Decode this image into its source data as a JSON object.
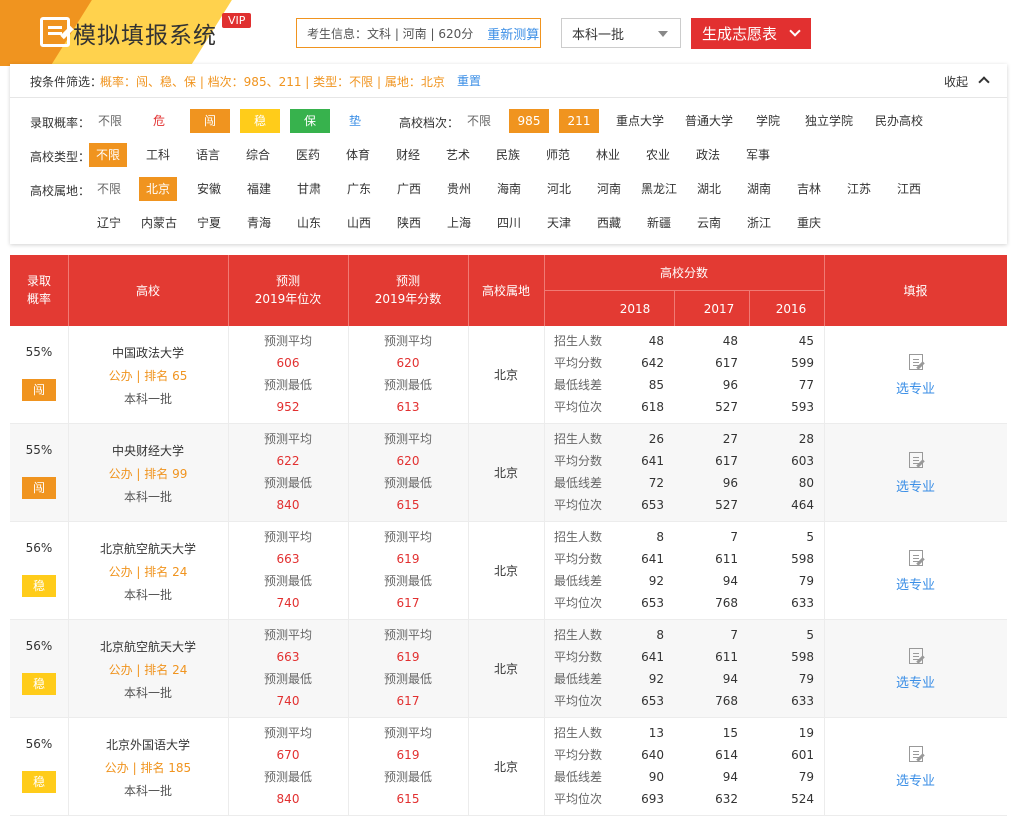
{
  "header": {
    "app_title": "模拟填报系统",
    "vip_label": "VIP",
    "student_info": "考生信息：文科 | 河南 | 620分",
    "remeasure_label": "重新测算",
    "batch_selected": "本科一批",
    "generate_label": "生成志愿表"
  },
  "colors": {
    "brand_orange": "#f0941f",
    "brand_yellow": "#ffd24d",
    "header_red": "#e33a33",
    "link_blue": "#3a8ee6",
    "wen": "#f0941f",
    "wen_text": "#ffffff",
    "wen2": "#ffcc1a",
    "bao": "#37b24d",
    "dian": "#3a8ee6"
  },
  "filter": {
    "summary_label": "按条件筛选：",
    "summary_value": "概率：闯、稳、保 | 档次：985、211 | 类型：不限 | 属地：北京",
    "reset_label": "重置",
    "collapse_label": "收起",
    "prob": {
      "label": "录取概率：",
      "options": [
        "不限",
        "危",
        "闯",
        "稳",
        "保",
        "垫"
      ]
    },
    "level": {
      "label": "高校档次：",
      "options": [
        "不限",
        "985",
        "211",
        "重点大学",
        "普通大学",
        "学院",
        "独立学院",
        "民办高校"
      ]
    },
    "type": {
      "label": "高校类型：",
      "options": [
        "不限",
        "工科",
        "语言",
        "综合",
        "医药",
        "体育",
        "财经",
        "艺术",
        "民族",
        "师范",
        "林业",
        "农业",
        "政法",
        "军事"
      ]
    },
    "location": {
      "label": "高校属地：",
      "row1": [
        "不限",
        "北京",
        "安徽",
        "福建",
        "甘肃",
        "广东",
        "广西",
        "贵州",
        "海南",
        "河北",
        "河南",
        "黑龙江",
        "湖北",
        "湖南",
        "吉林",
        "江苏",
        "江西"
      ],
      "row2": [
        "辽宁",
        "内蒙古",
        "宁夏",
        "青海",
        "山东",
        "山西",
        "陕西",
        "上海",
        "四川",
        "天津",
        "西藏",
        "新疆",
        "云南",
        "浙江",
        "重庆"
      ]
    }
  },
  "table": {
    "headers": {
      "prob": "录取\n概率",
      "school": "高校",
      "rank": "预测\n2019年位次",
      "score": "预测\n2019年分数",
      "loc": "高校属地",
      "scores_group": "高校分数",
      "y2018": "2018",
      "y2017": "2017",
      "y2016": "2016",
      "fill": "填报"
    },
    "stat_labels": [
      "招生人数",
      "平均分数",
      "最低线差",
      "平均位次"
    ],
    "pred_labels": [
      "预测平均",
      "预测最低"
    ],
    "select_label": "选专业",
    "rows": [
      {
        "rate": "55%",
        "tag": "闯",
        "name": "中国政法大学",
        "rank_line": "公办 | 排名 65",
        "batch": "本科一批",
        "rank_avg": "606",
        "rank_min": "952",
        "score_avg": "620",
        "score_min": "613",
        "loc": "北京",
        "stats": [
          [
            "48",
            "48",
            "45"
          ],
          [
            "642",
            "617",
            "599"
          ],
          [
            "85",
            "96",
            "77"
          ],
          [
            "618",
            "527",
            "593"
          ]
        ]
      },
      {
        "rate": "55%",
        "tag": "闯",
        "name": "中央财经大学",
        "rank_line": "公办 | 排名 99",
        "batch": "本科一批",
        "rank_avg": "622",
        "rank_min": "840",
        "score_avg": "620",
        "score_min": "615",
        "loc": "北京",
        "stats": [
          [
            "26",
            "27",
            "28"
          ],
          [
            "641",
            "617",
            "603"
          ],
          [
            "72",
            "96",
            "80"
          ],
          [
            "653",
            "527",
            "464"
          ]
        ]
      },
      {
        "rate": "56%",
        "tag": "稳",
        "name": "北京航空航天大学",
        "rank_line": "公办 | 排名 24",
        "batch": "本科一批",
        "rank_avg": "663",
        "rank_min": "740",
        "score_avg": "619",
        "score_min": "617",
        "loc": "北京",
        "stats": [
          [
            "8",
            "7",
            "5"
          ],
          [
            "641",
            "611",
            "598"
          ],
          [
            "92",
            "94",
            "79"
          ],
          [
            "653",
            "768",
            "633"
          ]
        ]
      },
      {
        "rate": "56%",
        "tag": "稳",
        "name": "北京航空航天大学",
        "rank_line": "公办 | 排名 24",
        "batch": "本科一批",
        "rank_avg": "663",
        "rank_min": "740",
        "score_avg": "619",
        "score_min": "617",
        "loc": "北京",
        "stats": [
          [
            "8",
            "7",
            "5"
          ],
          [
            "641",
            "611",
            "598"
          ],
          [
            "92",
            "94",
            "79"
          ],
          [
            "653",
            "768",
            "633"
          ]
        ]
      },
      {
        "rate": "56%",
        "tag": "稳",
        "name": "北京外国语大学",
        "rank_line": "公办 | 排名 185",
        "batch": "本科一批",
        "rank_avg": "670",
        "rank_min": "840",
        "score_avg": "619",
        "score_min": "615",
        "loc": "北京",
        "stats": [
          [
            "13",
            "15",
            "19"
          ],
          [
            "640",
            "614",
            "601"
          ],
          [
            "90",
            "94",
            "79"
          ],
          [
            "693",
            "632",
            "524"
          ]
        ]
      }
    ]
  }
}
